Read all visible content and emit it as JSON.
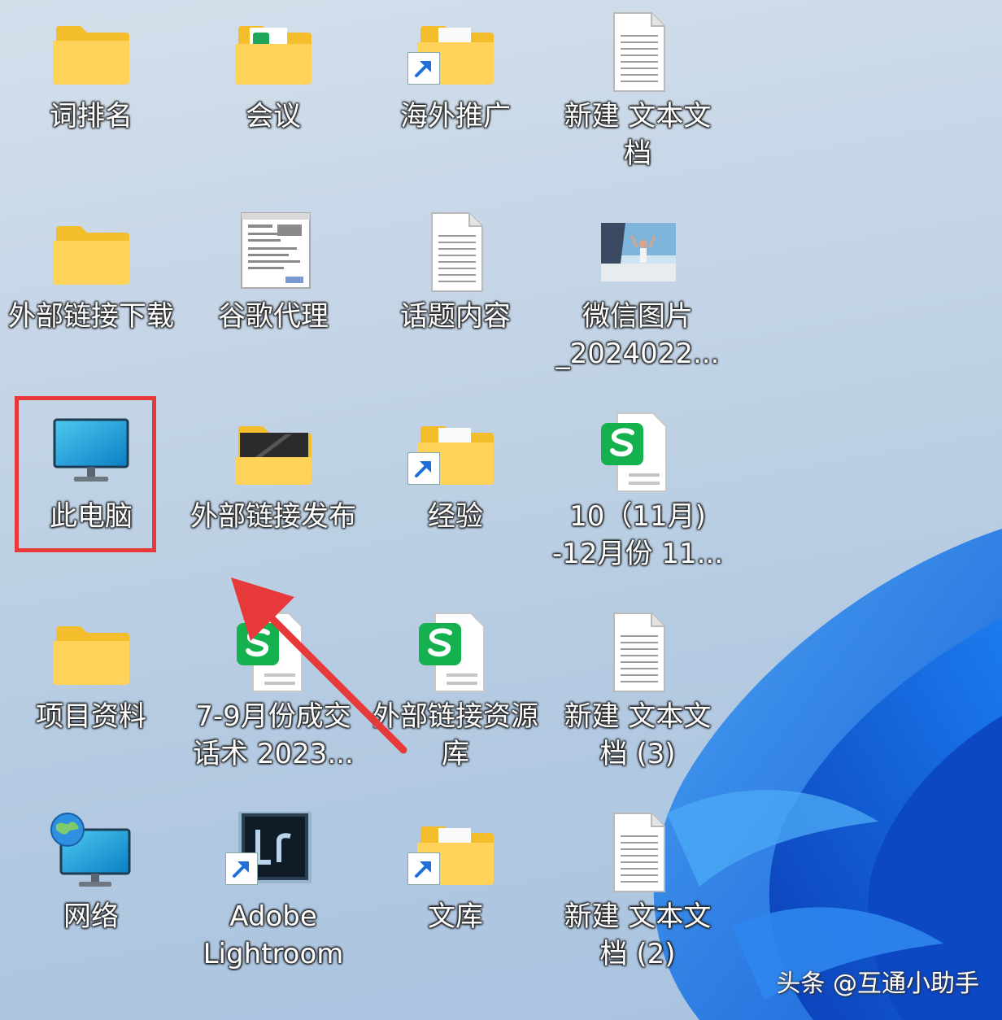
{
  "desktop": {
    "icons": [
      {
        "label": "词排名",
        "type": "folder"
      },
      {
        "label": "会议",
        "type": "folder-doc"
      },
      {
        "label": "海外推广",
        "type": "folder-shortcut"
      },
      {
        "label": "新建 文本文\n档",
        "type": "text-file"
      },
      {
        "label": "外部链接下载",
        "type": "folder"
      },
      {
        "label": "谷歌代理",
        "type": "screenshot-thumb"
      },
      {
        "label": "话题内容",
        "type": "text-file"
      },
      {
        "label": "微信图片\n_2024022...",
        "type": "photo-thumb"
      },
      {
        "label": "此电脑",
        "type": "this-pc"
      },
      {
        "label": "外部链接发布",
        "type": "folder-dark"
      },
      {
        "label": "经验",
        "type": "folder-shortcut"
      },
      {
        "label": "10（11月)\n-12月份 11...",
        "type": "sheet-file"
      },
      {
        "label": "项目资料",
        "type": "folder"
      },
      {
        "label": "7-9月份成交\n话术 2023...",
        "type": "sheet-file"
      },
      {
        "label": "外部链接资源\n库",
        "type": "sheet-file"
      },
      {
        "label": "新建 文本文\n档 (3)",
        "type": "text-file"
      },
      {
        "label": "网络",
        "type": "network"
      },
      {
        "label": "Adobe\nLightroom",
        "type": "lightroom-shortcut"
      },
      {
        "label": "文库",
        "type": "folder-shortcut"
      },
      {
        "label": "新建 文本文\n档 (2)",
        "type": "text-file"
      }
    ],
    "highlight_color": "#e8393a"
  },
  "watermark": "头条 @互通小助手"
}
